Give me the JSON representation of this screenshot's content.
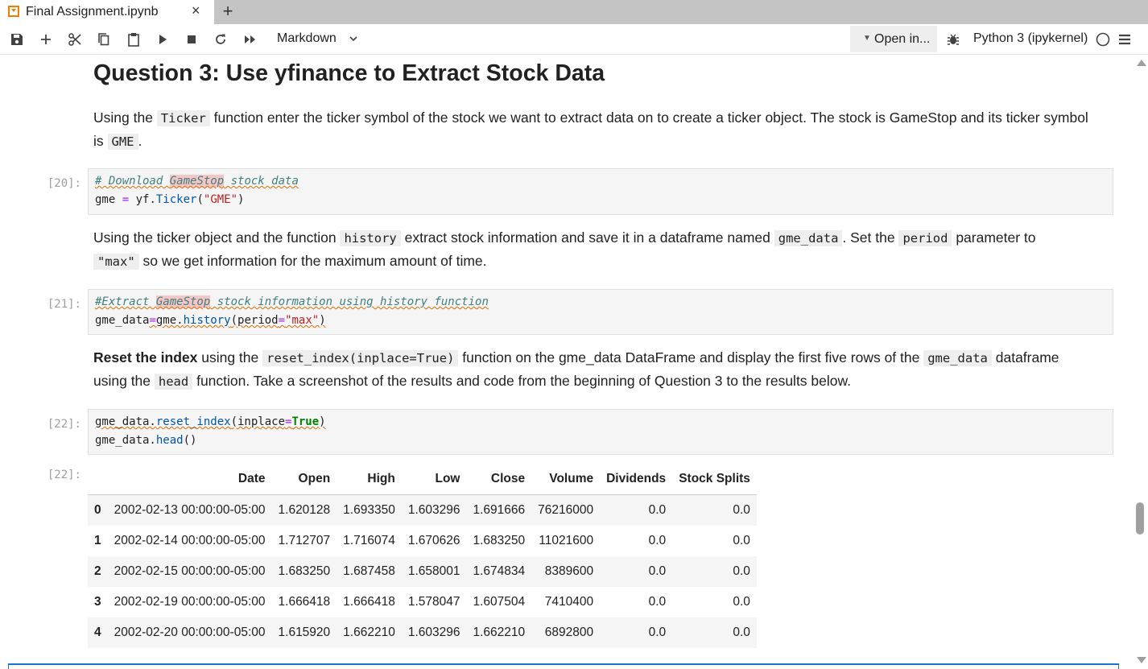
{
  "tab": {
    "title": "Final Assignment.ipynb",
    "close": "×",
    "add": "+"
  },
  "toolbar": {
    "cell_type": "Markdown",
    "open_in": "Open in...",
    "kernel": "Python 3 (ipykernel)",
    "icons": [
      "save-icon",
      "add-icon",
      "cut-icon",
      "copy-icon",
      "paste-icon",
      "run-icon",
      "stop-icon",
      "restart-icon",
      "run-all-icon"
    ]
  },
  "heading": "Question 3: Use yfinance to Extract Stock Data",
  "md1": {
    "t1": "Using the ",
    "c1": "Ticker",
    "t2": " function enter the ticker symbol of the stock we want to extract data on to create a ticker object. The stock is GameStop and its ticker symbol",
    "t3": "is ",
    "c2": "GME",
    "t4": "."
  },
  "cell20": {
    "prompt": "[20]:",
    "comment_a": "# Download ",
    "comment_hl": "GameStop",
    "comment_b": " stock data",
    "l2_a": "gme ",
    "l2_op": "=",
    "l2_b": " yf.",
    "l2_fn": "Ticker",
    "l2_c": "(",
    "l2_str": "\"GME\"",
    "l2_d": ")"
  },
  "md2": {
    "t1": "Using the ticker object and the function ",
    "c1": "history",
    "t2": " extract stock information and save it in a dataframe named ",
    "c2": "gme_data",
    "t3": ". Set the ",
    "c3": "period",
    "t4": " parameter to",
    "c4": "\"max\"",
    "t5": " so we get information for the maximum amount of time."
  },
  "cell21": {
    "prompt": "[21]:",
    "comment_a": "#Extract ",
    "comment_hl": "GameStop",
    "comment_b": " stock information using history function",
    "l2_a": "gme_data",
    "l2_op": "=",
    "l2_b": "gme.",
    "l2_fn": "history",
    "l2_c": "(period",
    "l2_op2": "=",
    "l2_str": "\"max\"",
    "l2_d": ")"
  },
  "md3": {
    "b1": "Reset the index",
    "t1": " using the ",
    "c1": "reset_index(inplace=True)",
    "t2": " function on the gme_data DataFrame and display the first five rows of the ",
    "c2": "gme_data",
    "t3": " dataframe",
    "t4": "using the ",
    "c3": "head",
    "t5": " function. Take a screenshot of the results and code from the beginning of Question 3 to the results below."
  },
  "cell22": {
    "prompt": "[22]:",
    "l1_a": "gme_data.",
    "l1_fn": "reset_index",
    "l1_b": "(inplace",
    "l1_op": "=",
    "l1_kw": "True",
    "l1_c": ")",
    "l2_a": "gme_data.",
    "l2_fn": "head",
    "l2_b": "()"
  },
  "output22": {
    "prompt": "[22]:",
    "columns": [
      "",
      "Date",
      "Open",
      "High",
      "Low",
      "Close",
      "Volume",
      "Dividends",
      "Stock Splits"
    ],
    "rows": [
      [
        "0",
        "2002-02-13 00:00:00-05:00",
        "1.620128",
        "1.693350",
        "1.603296",
        "1.691666",
        "76216000",
        "0.0",
        "0.0"
      ],
      [
        "1",
        "2002-02-14 00:00:00-05:00",
        "1.712707",
        "1.716074",
        "1.670626",
        "1.683250",
        "11021600",
        "0.0",
        "0.0"
      ],
      [
        "2",
        "2002-02-15 00:00:00-05:00",
        "1.683250",
        "1.687458",
        "1.658001",
        "1.674834",
        "8389600",
        "0.0",
        "0.0"
      ],
      [
        "3",
        "2002-02-19 00:00:00-05:00",
        "1.666418",
        "1.666418",
        "1.578047",
        "1.607504",
        "7410400",
        "0.0",
        "0.0"
      ],
      [
        "4",
        "2002-02-20 00:00:00-05:00",
        "1.615920",
        "1.662210",
        "1.603296",
        "1.662210",
        "6892800",
        "0.0",
        "0.0"
      ]
    ]
  }
}
